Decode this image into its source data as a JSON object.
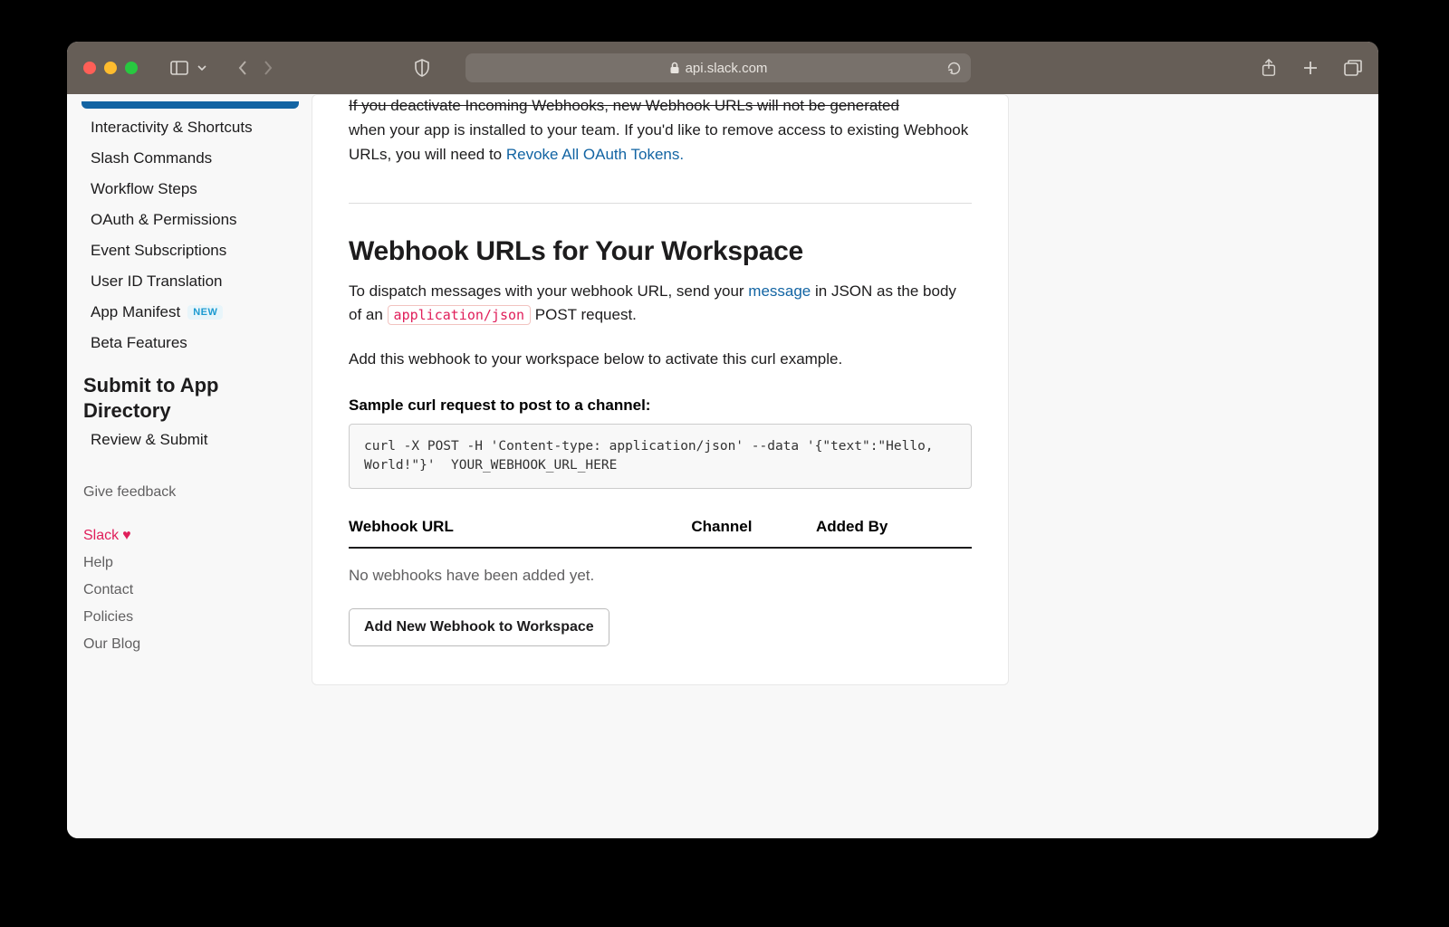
{
  "browser": {
    "url_display": "api.slack.com"
  },
  "sidebar": {
    "items": [
      {
        "label": "Interactivity & Shortcuts"
      },
      {
        "label": "Slash Commands"
      },
      {
        "label": "Workflow Steps"
      },
      {
        "label": "OAuth & Permissions"
      },
      {
        "label": "Event Subscriptions"
      },
      {
        "label": "User ID Translation"
      },
      {
        "label": "App Manifest",
        "badge": "NEW"
      },
      {
        "label": "Beta Features"
      }
    ],
    "submit_section": "Submit to App Directory",
    "review_submit": "Review & Submit",
    "give_feedback": "Give feedback",
    "footer": {
      "slack": "Slack",
      "help": "Help",
      "contact": "Contact",
      "policies": "Policies",
      "blog": "Our Blog"
    }
  },
  "main": {
    "deactivate_note_top": "If you deactivate Incoming Webhooks, new Webhook URLs will not be generated",
    "deactivate_note_rest": "when your app is installed to your team. If you'd like to remove access to existing Webhook URLs, you will need to ",
    "revoke_link": "Revoke All OAuth Tokens.",
    "heading": "Webhook URLs for Your Workspace",
    "dispatch_pre": "To dispatch messages with your webhook URL, send your ",
    "message_link": "message",
    "dispatch_mid": " in JSON as the body of an ",
    "app_json_code": "application/json",
    "dispatch_post": " POST request.",
    "activate_note": "Add this webhook to your workspace below to activate this curl example.",
    "sample_label": "Sample curl request to post to a channel:",
    "curl": "curl -X POST -H 'Content-type: application/json' --data '{\"text\":\"Hello, World!\"}'  YOUR_WEBHOOK_URL_HERE",
    "table": {
      "col_url": "Webhook URL",
      "col_channel": "Channel",
      "col_added": "Added By",
      "empty": "No webhooks have been added yet."
    },
    "add_button": "Add New Webhook to Workspace"
  }
}
